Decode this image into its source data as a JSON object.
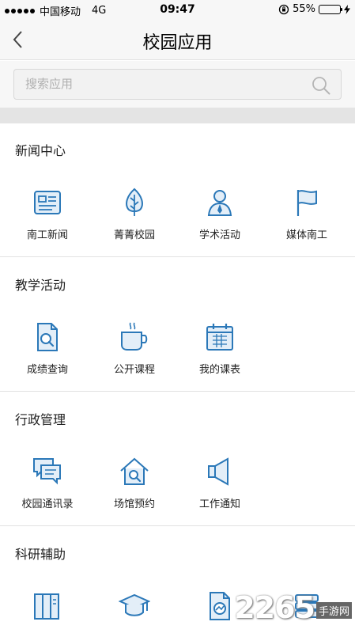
{
  "status_bar": {
    "carrier": "中国移动",
    "network": "4G",
    "time": "09:47",
    "battery_text": "55%",
    "battery_level": 0.55,
    "signal_icon": "signal-dots-icon",
    "lock_icon": "orientation-lock-icon",
    "charging_icon": "charging-bolt-icon"
  },
  "nav": {
    "title": "校园应用",
    "back_icon": "chevron-left-icon"
  },
  "search": {
    "placeholder": "搜索应用",
    "icon": "search-icon"
  },
  "accent_color": "#2b78b8",
  "sections": [
    {
      "title": "新闻中心",
      "items": [
        {
          "label": "南工新闻",
          "icon": "newspaper-icon"
        },
        {
          "label": "菁菁校园",
          "icon": "leaf-icon"
        },
        {
          "label": "学术活动",
          "icon": "person-icon"
        },
        {
          "label": "媒体南工",
          "icon": "flag-icon"
        }
      ]
    },
    {
      "title": "教学活动",
      "items": [
        {
          "label": "成绩查询",
          "icon": "document-search-icon"
        },
        {
          "label": "公开课程",
          "icon": "coffee-cup-icon"
        },
        {
          "label": "我的课表",
          "icon": "calendar-icon"
        }
      ]
    },
    {
      "title": "行政管理",
      "items": [
        {
          "label": "校园通讯录",
          "icon": "chat-bubbles-icon"
        },
        {
          "label": "场馆预约",
          "icon": "house-search-icon"
        },
        {
          "label": "工作通知",
          "icon": "megaphone-icon"
        }
      ]
    },
    {
      "title": "科研辅助",
      "items": [
        {
          "label": "",
          "icon": "books-icon"
        },
        {
          "label": "",
          "icon": "graduation-cap-icon"
        },
        {
          "label": "",
          "icon": "document-chart-icon"
        },
        {
          "label": "",
          "icon": "stack-icon"
        }
      ]
    }
  ],
  "watermark": {
    "number": "2265",
    "text": "手游网"
  }
}
